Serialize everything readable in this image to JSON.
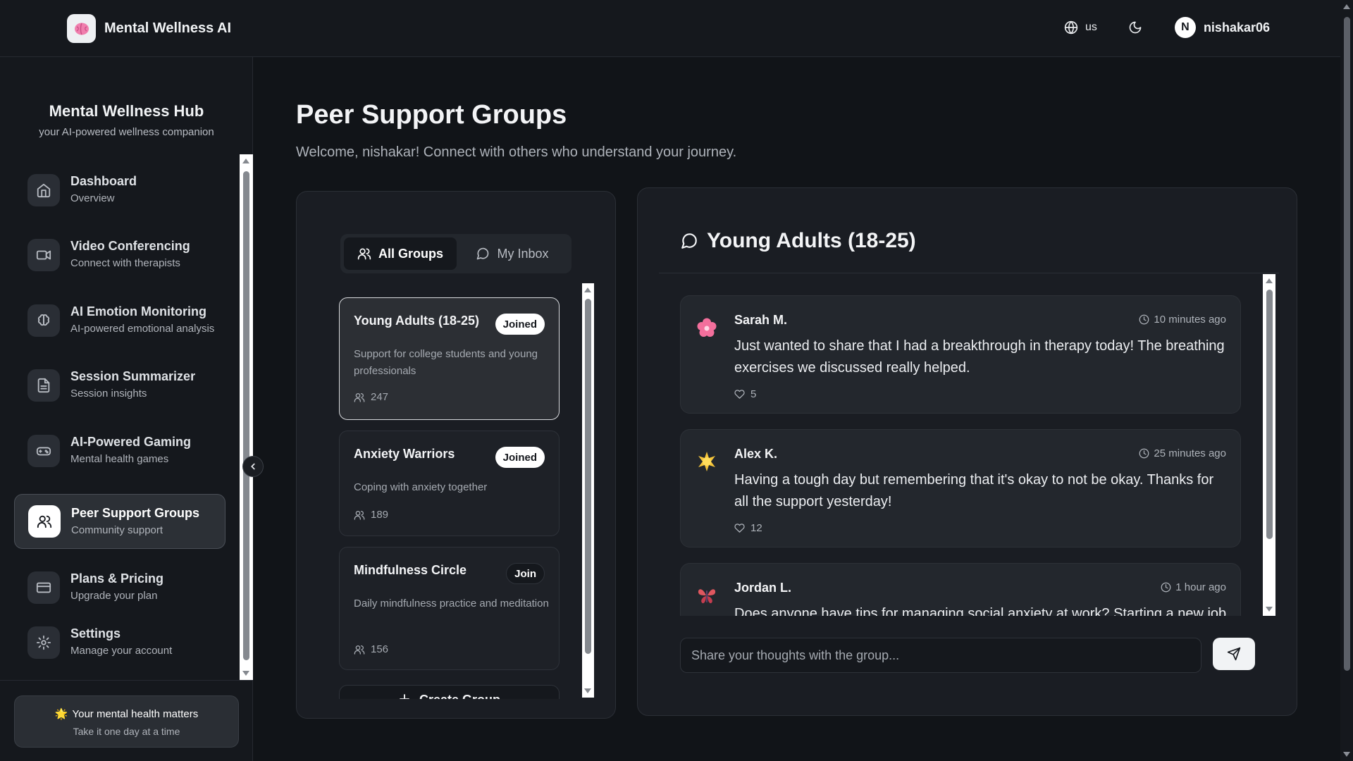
{
  "app": {
    "name": "Mental Wellness AI",
    "logo_icon": "brain-icon"
  },
  "header": {
    "language": "us",
    "user_initial": "N",
    "username": "nishakar06"
  },
  "sidebar": {
    "title": "Mental Wellness Hub",
    "subtitle": "your AI-powered wellness companion",
    "items": [
      {
        "label": "Dashboard",
        "desc": "Overview",
        "icon": "home-icon"
      },
      {
        "label": "Video Conferencing",
        "desc": "Connect with therapists",
        "icon": "video-icon"
      },
      {
        "label": "AI Emotion Monitoring",
        "desc": "AI-powered emotional analysis",
        "icon": "brain-icon"
      },
      {
        "label": "Session Summarizer",
        "desc": "Session insights",
        "icon": "file-text-icon"
      },
      {
        "label": "AI-Powered Gaming",
        "desc": "Mental health games",
        "icon": "gamepad-icon"
      },
      {
        "label": "Peer Support Groups",
        "desc": "Community support",
        "icon": "users-icon",
        "active": true
      },
      {
        "label": "Plans & Pricing",
        "desc": "Upgrade your plan",
        "icon": "credit-card-icon"
      },
      {
        "label": "Settings",
        "desc": "Manage your account",
        "icon": "gear-icon"
      }
    ],
    "motto": {
      "emoji": "🌟",
      "title": "Your mental health matters",
      "subtitle": "Take it one day at a time"
    }
  },
  "main": {
    "title": "Peer Support Groups",
    "subtitle": "Welcome, nishakar! Connect with others who understand your journey.",
    "tabs": [
      {
        "label": "All Groups",
        "icon": "users-icon",
        "active": true
      },
      {
        "label": "My Inbox",
        "icon": "message-circle-icon",
        "active": false
      }
    ],
    "groups": [
      {
        "name": "Young Adults (18-25)",
        "button": "Joined",
        "description": "Support for college students and young professionals",
        "members": "247",
        "selected": true
      },
      {
        "name": "Anxiety Warriors",
        "button": "Joined",
        "description": "Coping with anxiety together",
        "members": "189"
      },
      {
        "name": "Mindfulness Circle",
        "button": "Join",
        "description": "Daily mindfulness practice and meditation",
        "members": "156"
      }
    ],
    "create_group_label": "Create Group"
  },
  "chat": {
    "title": "Young Adults (18-25)",
    "messages": [
      {
        "emoji": "🌸",
        "name": "Sarah M.",
        "time": "10 minutes ago",
        "text": "Just wanted to share that I had a breakthrough in therapy today! The breathing exercises we discussed really helped.",
        "likes": "5"
      },
      {
        "emoji": "🌟",
        "name": "Alex K.",
        "time": "25 minutes ago",
        "text": "Having a tough day but remembering that it's okay to not be okay. Thanks for all the support yesterday!",
        "likes": "12"
      },
      {
        "emoji": "🦋",
        "name": "Jordan L.",
        "time": "1 hour ago",
        "text": "Does anyone have tips for managing social anxiety at work? Starting a new job",
        "likes": ""
      }
    ],
    "input_placeholder": "Share your thoughts with the group..."
  }
}
